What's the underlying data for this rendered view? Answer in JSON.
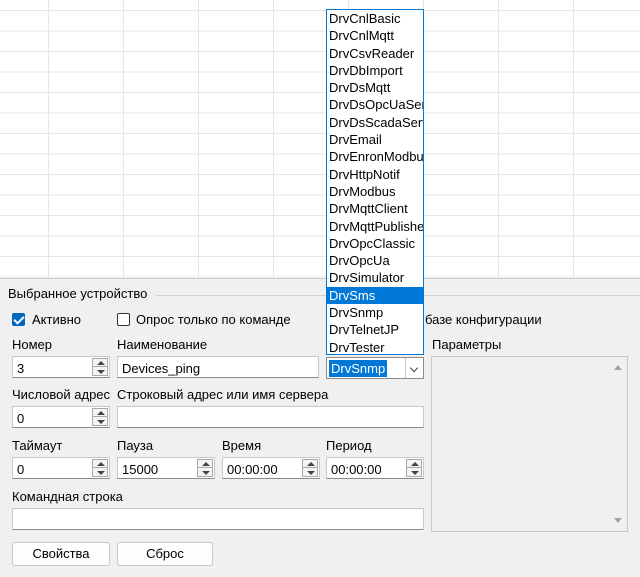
{
  "group": {
    "title": "Выбранное устройство"
  },
  "checkboxes": {
    "active": {
      "label": "Активно",
      "checked": true
    },
    "poll_on_command": {
      "label": "Опрос только по команде",
      "checked": false
    }
  },
  "config_note": "базе конфигурации",
  "fields": {
    "number": {
      "label": "Номер",
      "value": "3"
    },
    "name": {
      "label": "Наименование",
      "value": "Devices_ping"
    },
    "driver": {
      "value": "DrvSnmp"
    },
    "numeric_address": {
      "label": "Числовой адрес",
      "value": "0"
    },
    "string_address": {
      "label": "Строковый адрес или имя сервера",
      "value": ""
    },
    "timeout": {
      "label": "Таймаут",
      "value": "0"
    },
    "pause": {
      "label": "Пауза",
      "value": "15000"
    },
    "time": {
      "label": "Время",
      "value": "00:00:00"
    },
    "period": {
      "label": "Период",
      "value": "00:00:00"
    },
    "command_line": {
      "label": "Командная строка",
      "value": ""
    }
  },
  "params": {
    "label": "Параметры"
  },
  "buttons": {
    "properties": "Свойства",
    "reset": "Сброс"
  },
  "dropdown": {
    "items": [
      "DrvCnlBasic",
      "DrvCnlMqtt",
      "DrvCsvReader",
      "DrvDbImport",
      "DrvDsMqtt",
      "DrvDsOpcUaServer",
      "DrvDsScadaServer",
      "DrvEmail",
      "DrvEnronModbus",
      "DrvHttpNotif",
      "DrvModbus",
      "DrvMqttClient",
      "DrvMqttPublisher",
      "DrvOpcClassic",
      "DrvOpcUa",
      "DrvSimulator",
      "DrvSms",
      "DrvSnmp",
      "DrvTelnetJP",
      "DrvTester"
    ],
    "selected": "DrvSms"
  },
  "colors": {
    "accent": "#0078d7",
    "checkbox": "#0067c0"
  }
}
